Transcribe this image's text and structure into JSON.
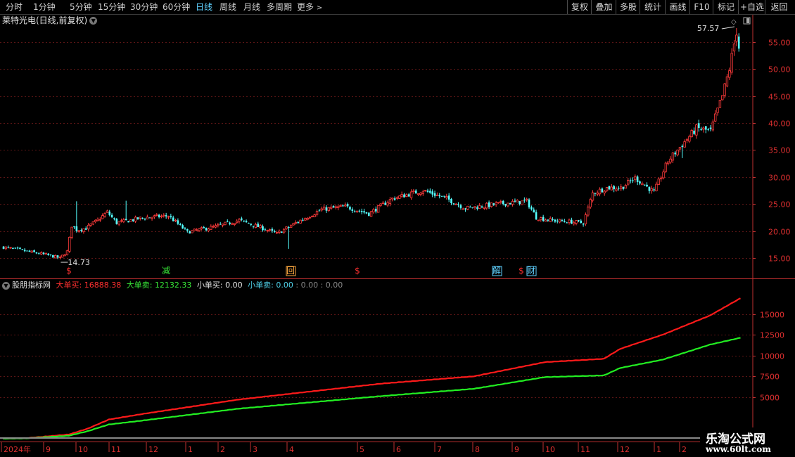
{
  "toolbar": {
    "periods": [
      "分时",
      "1分钟",
      "5分钟",
      "15分钟",
      "30分钟",
      "60分钟",
      "日线",
      "周线",
      "月线",
      "多周期",
      "更多"
    ],
    "active_period": "日线",
    "more_arrow": ">",
    "buttons": [
      "复权",
      "叠加",
      "多股",
      "统计",
      "画线",
      "F10",
      "标记",
      "+自选",
      "返回"
    ]
  },
  "stock_title": "莱特光电(日线,前复权)",
  "price_axis": {
    "ticks": [
      "55.00",
      "50.00",
      "45.00",
      "40.00",
      "35.00",
      "30.00",
      "25.00",
      "20.00",
      "15.00"
    ],
    "high_label": "57.57",
    "low_label": "14.73"
  },
  "event_markers": [
    {
      "label": "$",
      "color": "#ff3030",
      "type": "plain"
    },
    {
      "label": "减",
      "color": "#38e838",
      "type": "plain"
    },
    {
      "label": "回",
      "color": "#ffaa40",
      "type": "boxed"
    },
    {
      "label": "$",
      "color": "#ff3030",
      "type": "plain"
    },
    {
      "label": "解",
      "color": "#5fd1ff",
      "type": "boxed"
    },
    {
      "label": "$",
      "color": "#ff3030",
      "type": "plain"
    },
    {
      "label": "财",
      "color": "#5fd1ff",
      "type": "boxed"
    }
  ],
  "indicator": {
    "name": "股朋指标网",
    "big_buy_label": "大单买:",
    "big_buy_value": "16888.38",
    "big_sell_label": "大单卖:",
    "big_sell_value": "12132.33",
    "small_buy_label": "小单买:",
    "small_buy_value": "0.00",
    "small_sell_label": "小单卖:",
    "small_sell_value": "0.00",
    "extra1": ": 0.00",
    "extra2": ": 0.00",
    "axis_ticks": [
      "15000",
      "12500",
      "10000",
      "7500",
      "5000"
    ]
  },
  "time_axis": [
    "2024年",
    "9",
    "10",
    "11",
    "12",
    "1",
    "2",
    "3",
    "4",
    "5",
    "6",
    "7",
    "8",
    "9",
    "10",
    "11",
    "12",
    "1",
    "2",
    "3"
  ],
  "watermark": {
    "text": "乐淘公式网",
    "url": "www.60lt.com"
  },
  "colors": {
    "up": "#ff3b3b",
    "down": "#54ffff",
    "big_buy": "#ff1a1a",
    "big_sell": "#22ee22",
    "axis": "#c03030",
    "grid": "#5a1515"
  },
  "chart_data": [
    {
      "type": "candlestick",
      "title": "莱特光电(日线,前复权)",
      "ylim": [
        12,
        59
      ],
      "yticks": [
        15,
        20,
        25,
        30,
        35,
        40,
        45,
        50,
        55
      ],
      "x_labels": [
        "2024年",
        "9",
        "10",
        "11",
        "12",
        "1",
        "2",
        "3",
        "4",
        "5",
        "6",
        "7",
        "8",
        "9",
        "10",
        "11",
        "12",
        "1",
        "2",
        "3"
      ],
      "annotations": [
        {
          "label": "57.57",
          "kind": "high"
        },
        {
          "label": "14.73",
          "kind": "low"
        }
      ],
      "close_keyframes": [
        {
          "i": 0,
          "c": 17.0
        },
        {
          "i": 18,
          "c": 15.6
        },
        {
          "i": 24,
          "c": 15.0
        },
        {
          "i": 27,
          "c": 16.2
        },
        {
          "i": 29,
          "c": 21.0
        },
        {
          "i": 31,
          "c": 20.2
        },
        {
          "i": 35,
          "c": 20.5
        },
        {
          "i": 40,
          "c": 22.0
        },
        {
          "i": 44,
          "c": 23.5
        },
        {
          "i": 48,
          "c": 21.5
        },
        {
          "i": 60,
          "c": 22.5
        },
        {
          "i": 70,
          "c": 22.8
        },
        {
          "i": 78,
          "c": 19.8
        },
        {
          "i": 90,
          "c": 20.8
        },
        {
          "i": 100,
          "c": 22.0
        },
        {
          "i": 110,
          "c": 20.5
        },
        {
          "i": 116,
          "c": 19.5
        },
        {
          "i": 124,
          "c": 21.5
        },
        {
          "i": 135,
          "c": 24.0
        },
        {
          "i": 145,
          "c": 24.5
        },
        {
          "i": 155,
          "c": 23.2
        },
        {
          "i": 165,
          "c": 26.0
        },
        {
          "i": 178,
          "c": 27.5
        },
        {
          "i": 188,
          "c": 26.0
        },
        {
          "i": 196,
          "c": 24.2
        },
        {
          "i": 210,
          "c": 25.0
        },
        {
          "i": 222,
          "c": 25.5
        },
        {
          "i": 226,
          "c": 22.5
        },
        {
          "i": 232,
          "c": 22.0
        },
        {
          "i": 246,
          "c": 21.5
        },
        {
          "i": 250,
          "c": 27.0
        },
        {
          "i": 256,
          "c": 28.0
        },
        {
          "i": 262,
          "c": 28.0
        },
        {
          "i": 268,
          "c": 29.8
        },
        {
          "i": 276,
          "c": 27.2
        },
        {
          "i": 282,
          "c": 33.0
        },
        {
          "i": 288,
          "c": 36.0
        },
        {
          "i": 294,
          "c": 39.0
        },
        {
          "i": 300,
          "c": 38.5
        },
        {
          "i": 305,
          "c": 45.0
        },
        {
          "i": 308,
          "c": 50.0
        },
        {
          "i": 311,
          "c": 57.0
        },
        {
          "i": 312,
          "c": 54.0
        }
      ],
      "spike_up": [
        {
          "i": 31,
          "high": 25.5
        },
        {
          "i": 52,
          "high": 25.6
        }
      ],
      "spike_down": [
        {
          "i": 121,
          "low": 16.7
        },
        {
          "i": 288,
          "low": 33.5
        }
      ]
    },
    {
      "type": "line",
      "title": "股朋指标网",
      "ylim": [
        0,
        17500
      ],
      "yticks": [
        5000,
        7500,
        10000,
        12500,
        15000
      ],
      "series": [
        {
          "name": "大单买",
          "final": 16888.38,
          "keyframes": [
            {
              "t": 0,
              "v": 0
            },
            {
              "t": 10,
              "v": 60
            },
            {
              "t": 28,
              "v": 500
            },
            {
              "t": 36,
              "v": 1200
            },
            {
              "t": 45,
              "v": 2300
            },
            {
              "t": 60,
              "v": 3000
            },
            {
              "t": 100,
              "v": 4700
            },
            {
              "t": 160,
              "v": 6600
            },
            {
              "t": 200,
              "v": 7500
            },
            {
              "t": 230,
              "v": 9200
            },
            {
              "t": 255,
              "v": 9600
            },
            {
              "t": 262,
              "v": 10800
            },
            {
              "t": 280,
              "v": 12500
            },
            {
              "t": 300,
              "v": 14800
            },
            {
              "t": 313,
              "v": 16888
            }
          ]
        },
        {
          "name": "大单卖",
          "final": 12132.33,
          "keyframes": [
            {
              "t": 0,
              "v": 0
            },
            {
              "t": 10,
              "v": 40
            },
            {
              "t": 28,
              "v": 350
            },
            {
              "t": 36,
              "v": 900
            },
            {
              "t": 45,
              "v": 1700
            },
            {
              "t": 60,
              "v": 2200
            },
            {
              "t": 100,
              "v": 3600
            },
            {
              "t": 160,
              "v": 5100
            },
            {
              "t": 200,
              "v": 6000
            },
            {
              "t": 230,
              "v": 7400
            },
            {
              "t": 255,
              "v": 7600
            },
            {
              "t": 262,
              "v": 8500
            },
            {
              "t": 280,
              "v": 9500
            },
            {
              "t": 300,
              "v": 11300
            },
            {
              "t": 313,
              "v": 12132
            }
          ]
        }
      ]
    }
  ]
}
